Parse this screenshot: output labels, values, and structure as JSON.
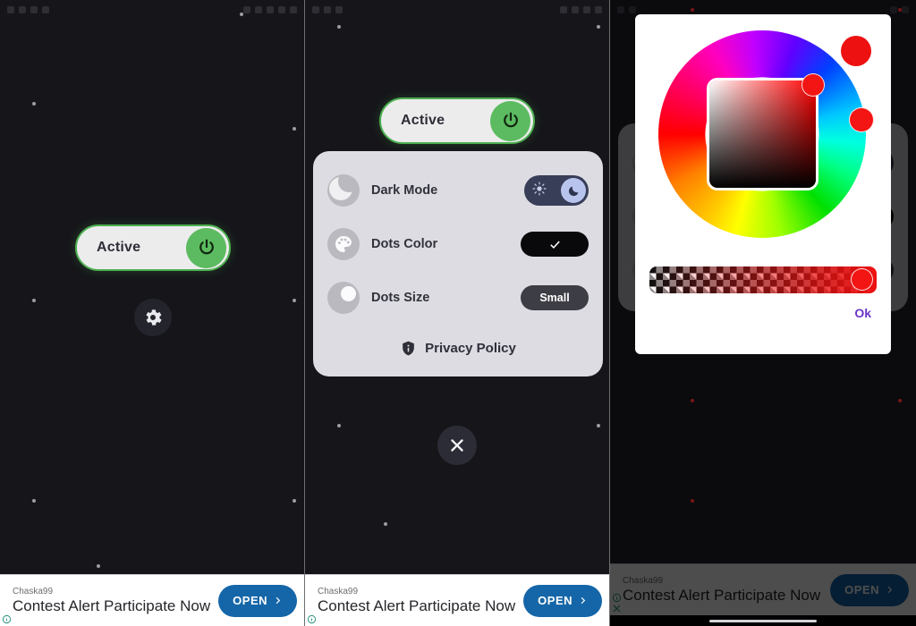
{
  "app": {
    "toggle_label": "Active",
    "power_icon": "power-icon",
    "gear_icon": "gear-icon",
    "close_icon": "close-icon"
  },
  "statusbar": {
    "time": "",
    "left_icons": [
      "signal-icon",
      "wifi-icon",
      "alarm-icon",
      "mail-icon"
    ],
    "right_icons": [
      "battery-icon",
      "vibrate-icon",
      "wifi-icon",
      "signal-icon",
      "clock-icon"
    ]
  },
  "settings": {
    "rows": [
      {
        "label": "Dark Mode",
        "icon": "moon-icon",
        "control": "toggle-switch",
        "value": "on"
      },
      {
        "label": "Dots Color",
        "icon": "palette-icon",
        "control": "color-chip",
        "value": "#09090b"
      },
      {
        "label": "Dots Size",
        "icon": "circle-half-icon",
        "control": "size-pill",
        "value": "Small"
      }
    ],
    "privacy": {
      "label": "Privacy Policy",
      "icon": "shield-info-icon"
    },
    "switch_icons": {
      "left": "sun-icon",
      "right": "moon-icon"
    },
    "check_icon": "check-icon"
  },
  "color_picker": {
    "ok_label": "Ok",
    "ok_color": "#6a35c9",
    "selected_color": "#ee1111",
    "wheel_name": "hue-wheel",
    "square_name": "saturation-value-square",
    "alpha_name": "alpha-slider",
    "preview_name": "color-preview-swatch"
  },
  "ad": {
    "advertiser": "Chaska99",
    "headline": "Contest Alert Participate Now",
    "cta_label": "OPEN",
    "cta_color": "#1566a8",
    "info_icon": "info-icon",
    "close_icon": "ad-close-icon"
  },
  "panels": [
    {
      "name": "home-screen",
      "dots_color": "#c9c9cf"
    },
    {
      "name": "settings-screen",
      "dots_color": "#c9c9cf"
    },
    {
      "name": "color-picker-screen",
      "dots_color": "#ef2b2b"
    }
  ]
}
